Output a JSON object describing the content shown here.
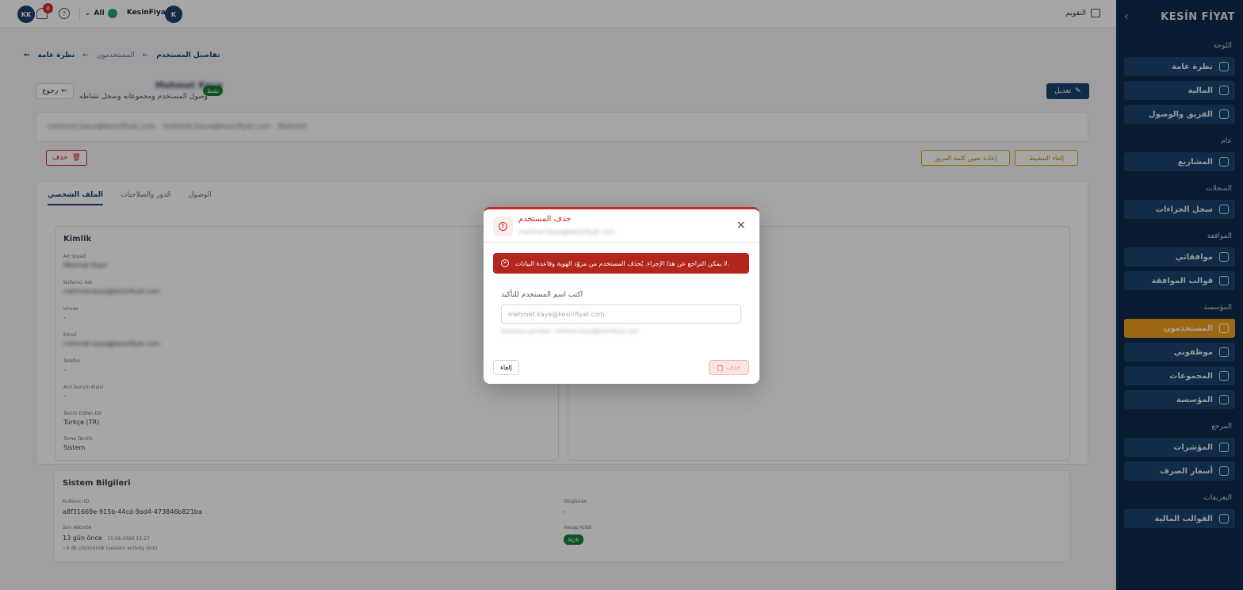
{
  "sidebar": {
    "logo": "KESİN FİYAT",
    "sections": [
      {
        "title": "اللوحة",
        "items": [
          {
            "label": "نظرة عامة",
            "icon": "home-icon"
          },
          {
            "label": "المالية",
            "icon": "finance-icon"
          },
          {
            "label": "الفريق والوصول",
            "icon": "team-icon"
          }
        ]
      },
      {
        "title": "عام",
        "items": [
          {
            "label": "المشاريع",
            "icon": "folder-icon"
          }
        ]
      },
      {
        "title": "السجلات",
        "items": [
          {
            "label": "سجل الجزاءات",
            "icon": "log-icon"
          }
        ]
      },
      {
        "title": "الموافقة",
        "items": [
          {
            "label": "موافقاتي",
            "icon": "approval-icon"
          },
          {
            "label": "قوالب الموافقة",
            "icon": "template-icon"
          }
        ]
      },
      {
        "title": "المؤسسة",
        "items": [
          {
            "label": "المستخدمون",
            "icon": "user-icon",
            "active": true
          },
          {
            "label": "موظفوني",
            "icon": "staff-icon"
          },
          {
            "label": "المجموعات",
            "icon": "groups-icon"
          },
          {
            "label": "المؤسسة",
            "icon": "org-icon"
          }
        ]
      },
      {
        "title": "المرجع",
        "items": [
          {
            "label": "المؤشرات",
            "icon": "indicator-icon"
          },
          {
            "label": "أسعار الصرف",
            "icon": "globe-icon"
          }
        ]
      },
      {
        "title": "التعريفات",
        "items": [
          {
            "label": "القوالب المالية",
            "icon": "external-icon"
          }
        ]
      }
    ]
  },
  "topbar": {
    "user_initials": "KK",
    "notifications": "8",
    "workspace": "All",
    "company": "KesinFiyat",
    "company_initial": "K",
    "calendar": "التقويم"
  },
  "breadcrumb": {
    "home": "نظرة عامة",
    "parent": "المستخدمون",
    "current": "تفاصيل المستخدم"
  },
  "page": {
    "back": "رجوع",
    "user_name": "Mehmet Kaya",
    "subtitle": "وصول المستخدم ومجموعاته وسجل نشاطه",
    "status": "نشط",
    "edit": "تعديل",
    "email_line": "mehmet.kaya@kesinfiyat.com · mehmet.kaya@kesinfiyat.com · Mehmet",
    "delete": "حذف",
    "reset_password": "إعادة تعيين كلمة المرور",
    "deactivate": "إلغاء التنشيط",
    "tabs": [
      "الملف الشخصي",
      "الدور والصلاحيات",
      "الوصول"
    ]
  },
  "identity": {
    "title": "Kimlik",
    "fields": [
      {
        "label": "Ad Soyad",
        "value": "Mehmet Kaya",
        "blur": true
      },
      {
        "label": "Kullanıcı Adı",
        "value": "mehmet.kaya@kesinfiyat.com",
        "blur": true
      },
      {
        "label": "Unvan",
        "value": "-"
      },
      {
        "label": "Email",
        "value": "mehmet.kaya@kesinfiyat.com",
        "blur": true
      },
      {
        "label": "Telefon",
        "value": "-"
      },
      {
        "label": "Acil Durum Kişisi",
        "value": "-"
      },
      {
        "label": "Tercih Edilen Dil",
        "value": "Türkçe (TR)"
      },
      {
        "label": "Tema Tercihi",
        "value": "Sistem"
      }
    ]
  },
  "system": {
    "title": "Sistem Bilgileri",
    "user_id_label": "Kullanıcı ID",
    "user_id": "a8f31669e-915b-44cd-9ad4-473846b821ba",
    "last_activity_label": "Son Aktivite",
    "last_activity": "13 gün önce",
    "last_activity_date": "15.09.2026 15:27",
    "last_activity_note": "~5 dk çözünürlük (session activity lock)",
    "created_label": "Oluşturan",
    "created": "-",
    "account_type_label": "Hesap Kilidi",
    "account_type": "Açık"
  },
  "modal": {
    "title": "حذف المستخدم",
    "subtitle": "mehmet.kaya@kesinfiyat.com",
    "close": "×",
    "alert": "لا يمكن التراجع عن هذا الإجراء. يُحذف المستخدم من مزوّد الهوية وقاعدة البيانات.",
    "input_label": "اكتب اسم المستخدم للتأكيد",
    "input_placeholder": "mehmet.kaya@kesinfiyat.com",
    "hint": "Yazmanız gereken: mehmet.kaya@kesinfiyat.com",
    "cancel": "إلغاء",
    "delete": "حذف"
  },
  "colors": {
    "primary": "#1b4271",
    "sidebar_bg": "#0f2a4a",
    "active_item": "#f0a11d",
    "danger": "#b3261e",
    "success": "#188038"
  }
}
